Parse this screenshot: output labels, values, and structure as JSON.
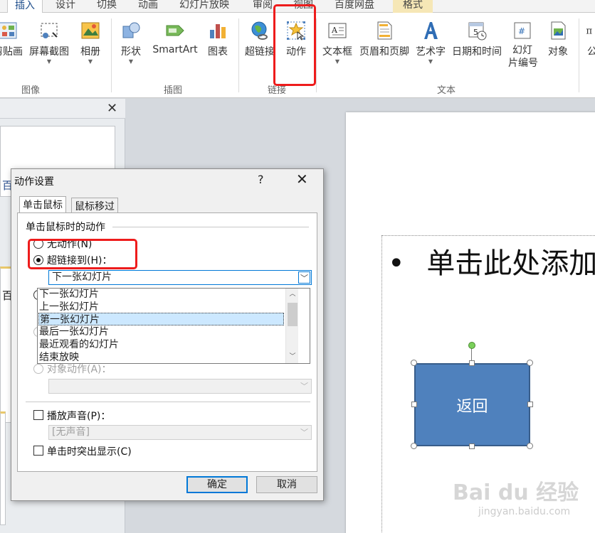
{
  "ribbon": {
    "tabs": [
      "插入",
      "设计",
      "切换",
      "动画",
      "幻灯片放映",
      "审阅",
      "视图",
      "百度网盘",
      "格式"
    ],
    "active_tab": "插入",
    "buttons": {
      "clipart": "剪贴画",
      "screenshot": "屏幕截图",
      "album": "相册",
      "shapes": "形状",
      "smartart": "SmartArt",
      "chart": "图表",
      "hyperlink": "超链接",
      "action": "动作",
      "textbox": "文本框",
      "header_footer": "页眉和页脚",
      "wordart": "艺术字",
      "datetime": "日期和时间",
      "slide_number_1": "幻灯",
      "slide_number_2": "片编号",
      "object": "对象",
      "equation": "公"
    },
    "groups": {
      "images": "图像",
      "illustrations": "插图",
      "links": "链接",
      "text": "文本"
    }
  },
  "left_pane": {
    "close_glyph": "✕",
    "thumb_text_1": "百",
    "thumb_text_2": "百"
  },
  "slide": {
    "bullet": "•",
    "placeholder_text": "单击此处添加",
    "shape_label": "返回"
  },
  "dialog": {
    "title": "动作设置",
    "help": "?",
    "close": "✕",
    "tabs": [
      "单击鼠标",
      "鼠标移过"
    ],
    "section_label": "单击鼠标时的动作",
    "radio_none": "无动作(N)",
    "radio_hyperlink": "超链接到(H)：",
    "radio_object": "对象动作(A)：",
    "hyperlink_value": "下一张幻灯片",
    "list_items": [
      "下一张幻灯片",
      "上一张幻灯片",
      "第一张幻灯片",
      "最后一张幻灯片",
      "最近观看的幻灯片",
      "结束放映"
    ],
    "selected_index": 2,
    "play_sound": "播放声音(P)：",
    "sound_value": "[无声音]",
    "highlight_click": "单击时突出显示(C)",
    "ok": "确定",
    "cancel": "取消"
  },
  "watermark": {
    "brand": "Bai du 经验",
    "url": "jingyan.baidu.com"
  },
  "colors": {
    "shape_fill": "#4f81bd",
    "highlight_red": "#ee1c1c",
    "selection": "#cce8ff"
  }
}
